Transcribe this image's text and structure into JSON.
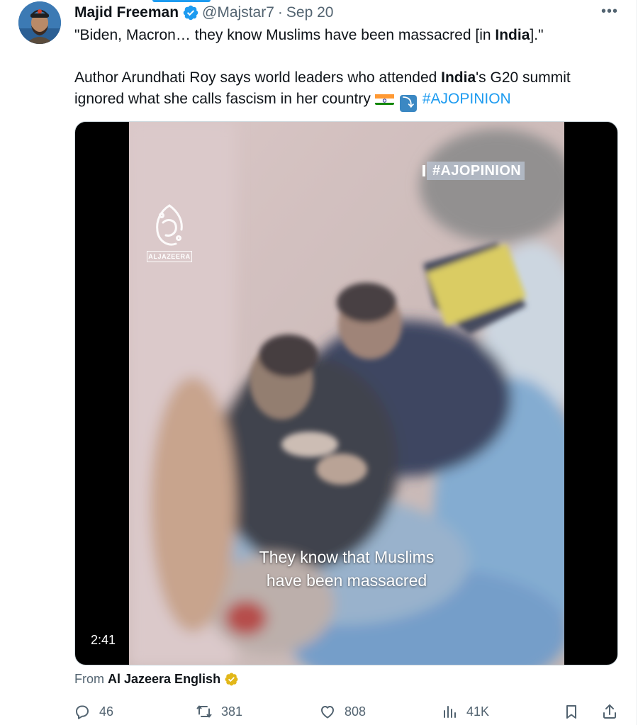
{
  "tweet": {
    "author": {
      "name": "Majid Freeman",
      "handle": "@Majstar7",
      "separator": "·",
      "date": "Sep 20",
      "verified_color": "#1d9bf0"
    },
    "text": {
      "line1": {
        "before": "\"Biden, Macron… they know Muslims have been massacred [in ",
        "bold": "India",
        "after": "].\""
      },
      "line2": {
        "before": "Author Arundhati Roy says world leaders who attended ",
        "bold": "India",
        "after": "'s G20 summit ignored what she calls fascism in her country"
      },
      "emojis": [
        "india-flag",
        "arrow-down-right"
      ],
      "hashtag": "#AJOPINION"
    },
    "media": {
      "overlay_tag": "#AJOPINION",
      "logo_text": "ALJAZEERA",
      "subtitle_line1": "They know that Muslims",
      "subtitle_line2": "have been massacred",
      "duration": "2:41"
    },
    "source": {
      "prefix": "From",
      "name": "Al Jazeera English",
      "badge_color": "#e2b719"
    },
    "actions": {
      "replies": "46",
      "reposts": "381",
      "likes": "808",
      "views": "41K"
    },
    "icons": {
      "more": "more-icon",
      "reply": "reply-icon",
      "repost": "repost-icon",
      "like": "heart-icon",
      "views": "analytics-icon",
      "bookmark": "bookmark-icon",
      "share": "share-icon"
    },
    "colors": {
      "link": "#1d9bf0",
      "text": "#0f1419",
      "secondary": "#536471"
    }
  }
}
